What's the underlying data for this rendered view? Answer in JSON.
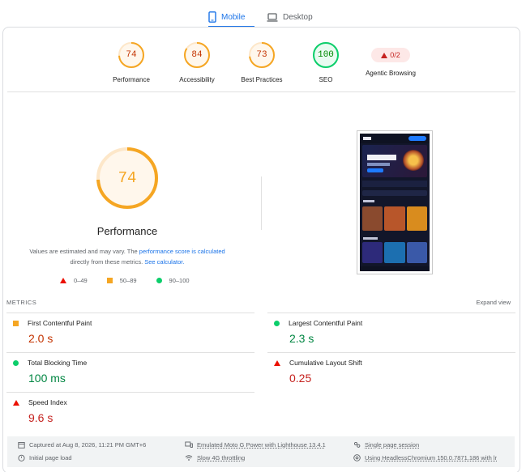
{
  "tabs": [
    {
      "label": "Mobile",
      "icon": "smartphone-icon",
      "active": true
    },
    {
      "label": "Desktop",
      "icon": "laptop-icon",
      "active": false
    }
  ],
  "categories": [
    {
      "name": "Performance",
      "score": "74",
      "color": "#f5a623",
      "fraction": 0.74
    },
    {
      "name": "Accessibility",
      "score": "84",
      "color": "#f5a623",
      "fraction": 0.84
    },
    {
      "name": "Best Practices",
      "score": "73",
      "color": "#f5a623",
      "fraction": 0.73
    },
    {
      "name": "SEO",
      "score": "100",
      "color": "#0cce6b",
      "fraction": 1.0
    },
    {
      "name": "Agentic Browsing",
      "score": "0/2",
      "color": "#c5221f"
    }
  ],
  "performance": {
    "score": "74",
    "fraction": 0.74,
    "title": "Performance",
    "note_part1": "Values are estimated and may vary. The ",
    "note_link1": "performance score is calculated",
    "note_part2": " directly from these metrics. ",
    "note_link2": "See calculator.",
    "legend": [
      "0–49",
      "50–89",
      "90–100"
    ]
  },
  "metrics": {
    "header": "METRICS",
    "expand_label": "Expand view",
    "items": [
      {
        "name": "First Contentful Paint",
        "value": "2.0 s",
        "status": "average"
      },
      {
        "name": "Largest Contentful Paint",
        "value": "2.3 s",
        "status": "pass"
      },
      {
        "name": "Total Blocking Time",
        "value": "100 ms",
        "status": "pass"
      },
      {
        "name": "Cumulative Layout Shift",
        "value": "0.25",
        "status": "fail"
      },
      {
        "name": "Speed Index",
        "value": "9.6 s",
        "status": "fail"
      }
    ]
  },
  "footer": {
    "captured": "Captured at Aug 8, 2026, 11:21 PM GMT+6",
    "load": "Initial page load",
    "device": "Emulated Moto G Power with Lighthouse 13.4.1",
    "throttling": "Slow 4G throttling",
    "session": "Single page session",
    "browser": "Using HeadlessChromium 150.0.7871.186 with lr"
  },
  "colors": {
    "accent": "#1a73e8",
    "average": "#f5a623",
    "pass": "#0cce6b",
    "fail": "#eb0f00"
  }
}
